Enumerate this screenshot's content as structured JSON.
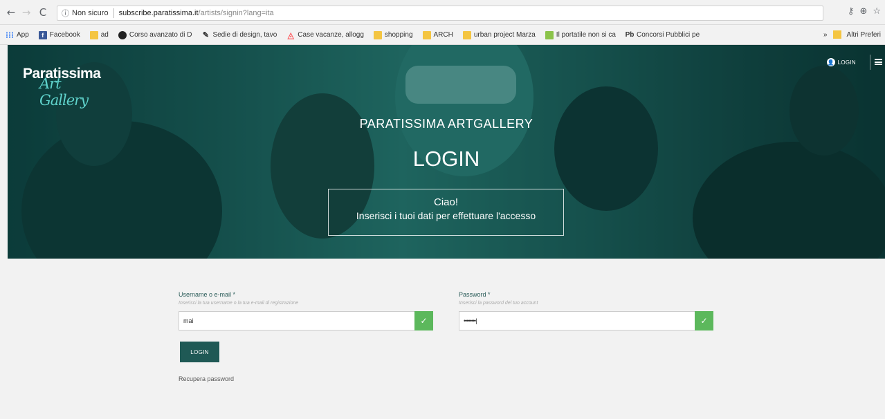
{
  "browser": {
    "nav": {
      "back": "←",
      "forward": "→",
      "reload": "C"
    },
    "security_label": "Non sicuro",
    "url_domain": "subscribe.paratissima.it",
    "url_path": "/artists/signin?lang=ita",
    "right_icons": {
      "key": "⚷",
      "zoom": "⊕",
      "star": "☆"
    }
  },
  "bookmarks": {
    "items": [
      {
        "label": "App",
        "icon": "apps-icon",
        "glyph": "⁞⁞⁞"
      },
      {
        "label": "Facebook",
        "icon": "facebook-icon",
        "glyph": "f"
      },
      {
        "label": "ad",
        "icon": "folder-icon",
        "glyph": ""
      },
      {
        "label": "Corso avanzato di D",
        "icon": "moon-icon",
        "glyph": ""
      },
      {
        "label": "Sedie di design, tavo",
        "icon": "pen-icon",
        "glyph": "✎"
      },
      {
        "label": "Case vacanze, allogg",
        "icon": "airbnb-icon",
        "glyph": "◬"
      },
      {
        "label": "shopping",
        "icon": "folder-icon",
        "glyph": ""
      },
      {
        "label": "ARCH",
        "icon": "folder-icon",
        "glyph": ""
      },
      {
        "label": "urban project Marza",
        "icon": "folder-icon",
        "glyph": ""
      },
      {
        "label": "Il portatile non si ca",
        "icon": "grid-icon",
        "glyph": ""
      },
      {
        "label": "Concorsi Pubblici pe",
        "icon": "pb-icon",
        "glyph": "Pb"
      }
    ],
    "overflow": "»",
    "other_label": "Altri Preferi"
  },
  "header": {
    "logo_main": "Paratissima",
    "logo_script": "Art Gallery",
    "login_label": "LOGIN"
  },
  "hero": {
    "subtitle": "PARATISSIMA ARTGALLERY",
    "title": "LOGIN",
    "box_line1": "Ciao!",
    "box_line2": "Inserisci i tuoi dati per effettuare l'accesso"
  },
  "form": {
    "username": {
      "label": "Username o e-mail *",
      "hint": "Inserisci la tua username o la tua e-mail di registrazione",
      "value": "mai"
    },
    "password": {
      "label": "Password *",
      "hint": "Inserisci la password del tuo account",
      "value": "••••••••|"
    },
    "check_glyph": "✓",
    "login_button": "LOGIN",
    "recover_link": "Recupera password"
  },
  "colors": {
    "accent": "#1f5955",
    "success": "#5cb85c",
    "hero_tint": "#1c5a56"
  }
}
